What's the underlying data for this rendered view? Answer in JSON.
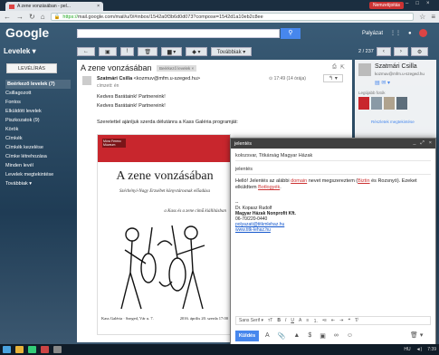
{
  "browser": {
    "tab_title": "A zene vonzásában - pel...",
    "url_prefix": "https://",
    "url": "mail.google.com/mail/u/0/#inbox/1542a0f3b6d0d073?compose=1542d1a10eb2c8ee",
    "user_badge": "Nemzetijoitás"
  },
  "gmail": {
    "logo": "Google",
    "mail_selector": "Levelek ▾",
    "account_label": "Palyázat",
    "compose_label": "LEVÉLÍRÁS",
    "more_label": "Továbbiak ▾",
    "pager": "2 / 237"
  },
  "sidebar": {
    "items": [
      {
        "label": "Beérkező levelek (7)",
        "active": true
      },
      {
        "label": "Csillagozott"
      },
      {
        "label": "Fontos"
      },
      {
        "label": "Elküldött levelek"
      },
      {
        "label": "Piszkozatok (9)"
      },
      {
        "label": "Körök"
      },
      {
        "label": "Címkék"
      },
      {
        "label": "Címkék kezelése"
      },
      {
        "label": "Címke létrehozása"
      },
      {
        "label": "Minden levél"
      },
      {
        "label": "Levelek megtekintése"
      },
      {
        "label": "Továbbiak ▾"
      }
    ]
  },
  "message": {
    "subject": "A zene vonzásában",
    "inbox_tag": "Beérkező levelek ×",
    "sender_name": "Szatmári Csilla",
    "sender_email": "<kozmuv@mfm.u-szeged.hu>",
    "recipient": "címzett: én",
    "time": "17:49 (14 órája)",
    "lines": [
      "Kedves Barátaink! Partnereink!",
      "Kedves Barátaink! Partnereink!",
      "Szeretettel ajánljuk szerda délutánra a Kass Galéria programját:"
    ]
  },
  "poster": {
    "logo": "Móra Ferenc Múzeum",
    "title": "A zene vonzásában",
    "subtitle": "Széchényi-Nagy Erzsébet könyvtárosnak előadása",
    "subtitle2": "a Kass és a zene című kiállításban",
    "footer_left": "Kass Galéria · Szeged, Vár u. 7.",
    "footer_right": "2016. április 20. szerda 17:00"
  },
  "contact_panel": {
    "name": "Szatmári Csilla",
    "email": "kozmuv@mfm.u-szeged.hu",
    "recent": "Legújabb fotók",
    "more": "Részletek megtekintése"
  },
  "compose": {
    "title": "jelentés",
    "to": "kolozsvar, Titkárság Magyar Házak",
    "subject": "jelentés",
    "body_pre": "Helló! Jelentés az alábbi ",
    "body_u1": "domain",
    "body_mid": " nevet megszereztem (",
    "body_u2": "Biztin",
    "body_mid2": " és Rozsnyó). Ezeket elküldtem ",
    "body_u3": "Botlogyék",
    "body_end": ".",
    "sig_dash": "--",
    "sig_name": "Dr. Kopasz Rudolf",
    "sig_org": "Magyar Házak Nonprofit Kft.",
    "sig_phone": "06-70/220-0440",
    "sig_email": "polyazati@titkmlehaz.hu",
    "sig_web": "www.titk-lehaz.hu",
    "font": "Sans Serif ▾",
    "send": "Küldés"
  },
  "taskbar": {
    "lang": "HU",
    "clock": "7:39"
  }
}
